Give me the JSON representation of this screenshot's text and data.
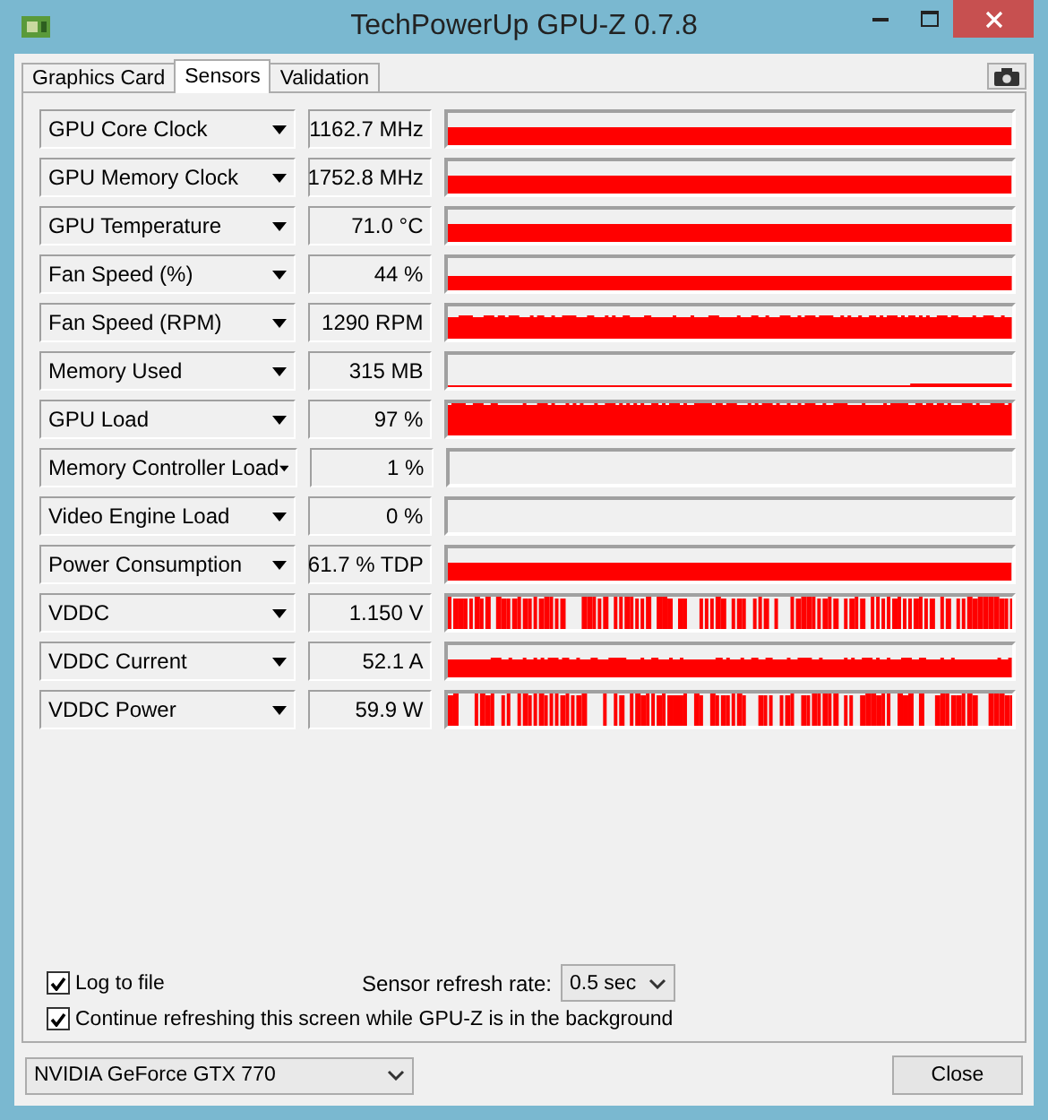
{
  "window": {
    "title": "TechPowerUp GPU-Z 0.7.8"
  },
  "tabs": [
    {
      "label": "Graphics Card",
      "selected": false
    },
    {
      "label": "Sensors",
      "selected": true
    },
    {
      "label": "Validation",
      "selected": false
    }
  ],
  "sensors": [
    {
      "name": "GPU Core Clock",
      "reading": "1162.7 MHz",
      "kind": "high"
    },
    {
      "name": "GPU Memory Clock",
      "reading": "1752.8 MHz",
      "kind": "high"
    },
    {
      "name": "GPU Temperature",
      "reading": "71.0 °C",
      "kind": "high"
    },
    {
      "name": "Fan Speed (%)",
      "reading": "44 %",
      "kind": "mid"
    },
    {
      "name": "Fan Speed (RPM)",
      "reading": "1290 RPM",
      "kind": "jitterhigh"
    },
    {
      "name": "Memory Used",
      "reading": "315 MB",
      "kind": "lowstep"
    },
    {
      "name": "GPU Load",
      "reading": "97 %",
      "kind": "jitterfull"
    },
    {
      "name": "Memory Controller Load",
      "reading": "1 %",
      "kind": "idle"
    },
    {
      "name": "Video Engine Load",
      "reading": "0 %",
      "kind": "idle"
    },
    {
      "name": "Power Consumption",
      "reading": "61.7 % TDP",
      "kind": "high"
    },
    {
      "name": "VDDC",
      "reading": "1.150 V",
      "kind": "pulsed"
    },
    {
      "name": "VDDC Current",
      "reading": "52.1 A",
      "kind": "jittermid"
    },
    {
      "name": "VDDC Power",
      "reading": "59.9 W",
      "kind": "pulsed"
    }
  ],
  "options": [
    {
      "label": "Log to file",
      "checked": true
    },
    {
      "label": "Continue refreshing this screen while GPU-Z is in the background",
      "checked": true
    }
  ],
  "refresh_rate": {
    "label": "Sensor refresh rate:",
    "value": "0.5 sec"
  },
  "gpu_select": {
    "value": "NVIDIA GeForce GTX 770"
  },
  "buttons": [
    "Close"
  ]
}
